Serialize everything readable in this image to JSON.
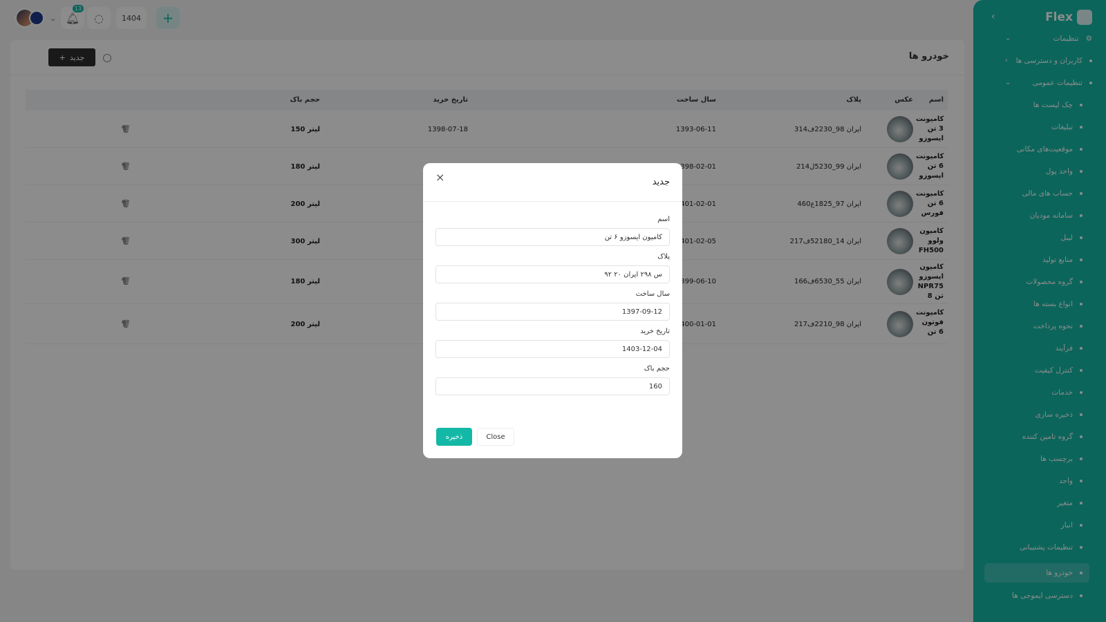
{
  "topbar": {
    "notif_count": "13",
    "year": "1404",
    "plus": "+"
  },
  "card": {
    "title": "خودرو ها",
    "new_label": "جدید"
  },
  "table": {
    "headers": {
      "name": "اسم",
      "photo": "عکس",
      "plate": "پلاک",
      "build_year": "سال ساخت",
      "buy_date": "تاریخ خرید",
      "tank": "حجم باک"
    },
    "rows": [
      {
        "name": "کامیونت 3 تن ایسوزو",
        "plate": "ایران 98_2230ف314",
        "build_year": "1393-06-11",
        "buy_date": "1398-07-18",
        "tank": "150 لیتر"
      },
      {
        "name": "کامیونت 6 تن ایسوزو",
        "plate": "ایران 99_5230ل214",
        "build_year": "1398-02-01",
        "buy_date": "",
        "tank": "180 لیتر"
      },
      {
        "name": "کامیونت 6 تن فورس",
        "plate": "ایران 97_1825ع460",
        "build_year": "1401-02-01",
        "buy_date": "",
        "tank": "200 لیتر"
      },
      {
        "name": "کامیون ولوو FH500",
        "plate": "ایران 14_52180ف217",
        "build_year": "1401-02-05",
        "buy_date": "",
        "tank": "300 لیتر"
      },
      {
        "name": "کامیون ایسوزو NPR75 8 تن",
        "plate": "ایران 55_6530ف166",
        "build_year": "1399-06-10",
        "buy_date": "",
        "tank": "180 لیتر"
      },
      {
        "name": "کامیونت فوتون 6 تن",
        "plate": "ایران 98_2210ف217",
        "build_year": "1400-01-01",
        "buy_date": "",
        "tank": "200 لیتر"
      }
    ]
  },
  "sidebar": {
    "logo": "Flex",
    "items": [
      {
        "label": "تنظیمات",
        "kind": "section"
      },
      {
        "label": "کاربران و دسترسی ها",
        "kind": "group"
      },
      {
        "label": "تنظیمات عمومی",
        "kind": "group"
      },
      {
        "label": "چک لیست ها",
        "kind": "sub"
      },
      {
        "label": "تبلیغات",
        "kind": "sub"
      },
      {
        "label": "موقعیت‌های مکانی",
        "kind": "sub"
      },
      {
        "label": "واحد پول",
        "kind": "sub"
      },
      {
        "label": "حساب های مالی",
        "kind": "sub"
      },
      {
        "label": "سامانه مودیان",
        "kind": "sub"
      },
      {
        "label": "لیبل",
        "kind": "sub"
      },
      {
        "label": "منابع تولید",
        "kind": "sub"
      },
      {
        "label": "گروه محصولات",
        "kind": "sub"
      },
      {
        "label": "انواع بسته ها",
        "kind": "sub"
      },
      {
        "label": "نحوه پرداخت",
        "kind": "sub"
      },
      {
        "label": "فرآیند",
        "kind": "sub"
      },
      {
        "label": "کنترل کیفیت",
        "kind": "sub"
      },
      {
        "label": "خدمات",
        "kind": "sub"
      },
      {
        "label": "ذخیره سازی",
        "kind": "sub"
      },
      {
        "label": "گروه تامین کننده",
        "kind": "sub"
      },
      {
        "label": "برچسب ها",
        "kind": "sub"
      },
      {
        "label": "واحد",
        "kind": "sub"
      },
      {
        "label": "متغیر",
        "kind": "sub"
      },
      {
        "label": "انبار",
        "kind": "sub"
      },
      {
        "label": "تنظیمات پشتیبانی",
        "kind": "sub"
      },
      {
        "label": "خودرو ها",
        "kind": "sub",
        "active": true
      },
      {
        "label": "دسترسی ایموجی ها",
        "kind": "sub"
      }
    ]
  },
  "modal": {
    "title": "جدید",
    "fields": [
      {
        "label": "اسم",
        "value": "کامیون ایسوزو ۶ تن"
      },
      {
        "label": "پلاک",
        "value": "۹۲ س ۲۹۸ ایران ۲۰"
      },
      {
        "label": "سال ساخت",
        "value": "1397-09-12"
      },
      {
        "label": "تاریخ خرید",
        "value": "1403-12-04"
      },
      {
        "label": "حجم باک",
        "value": "160"
      }
    ],
    "save_label": "ذخیره",
    "close_label": "Close"
  },
  "colors": {
    "accent": "#14b8a6",
    "dark_button": "#2f2f2f"
  }
}
